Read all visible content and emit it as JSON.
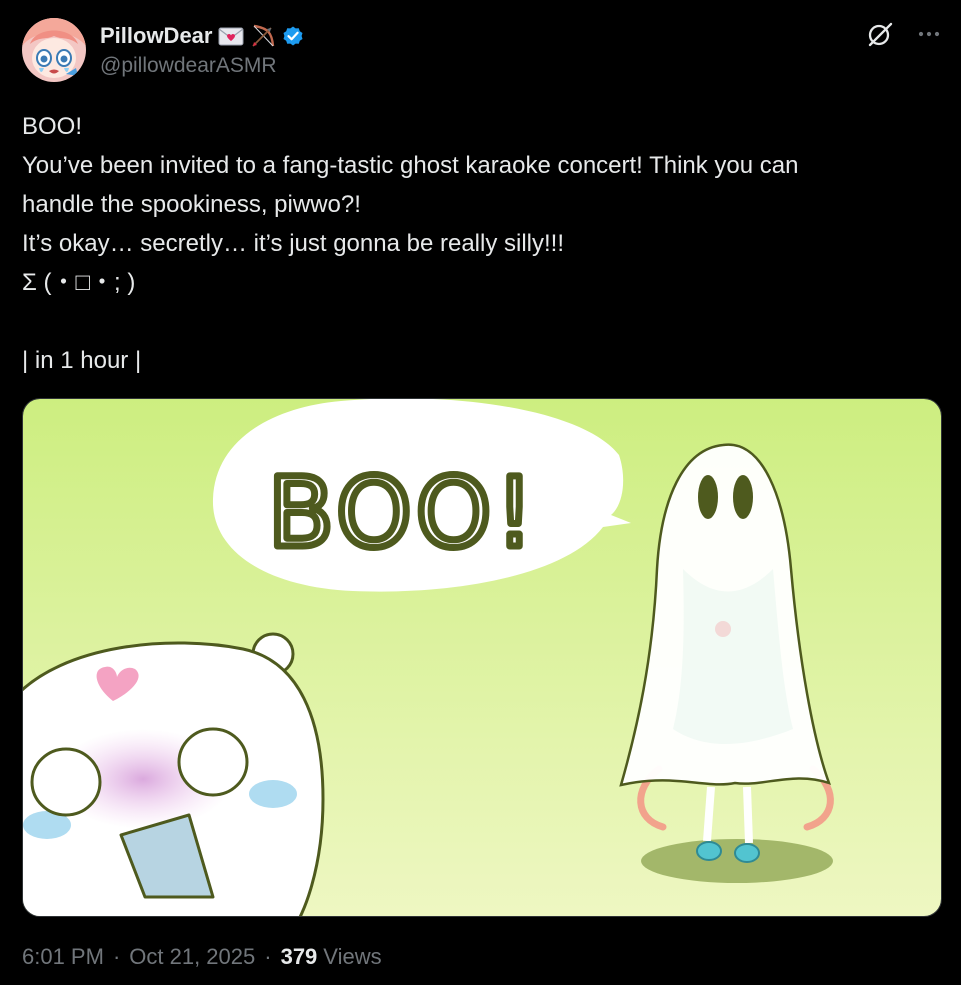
{
  "user": {
    "display_name": "PillowDear",
    "emojis": [
      "love-letter-emoji",
      "bow-and-arrow-emoji"
    ],
    "verified": true,
    "handle": "@pillowdearASMR"
  },
  "header_icons": [
    "grok-icon",
    "more-icon"
  ],
  "tweet": {
    "lines": [
      "BOO!",
      "You’ve been invited to a fang-tastic ghost karaoke concert! Think you can",
      "handle the spookiness, piwwo?!",
      "It’s okay… secretly… it’s just gonna be really silly!!!",
      "Σ (・□・; )",
      "",
      "| in 1 hour |"
    ]
  },
  "media": {
    "speech_bubble_text": "BOO!",
    "colors": {
      "background_top": "#cdee80",
      "background_bottom": "#eef7c2",
      "outline": "#4e5a1e"
    }
  },
  "meta": {
    "time": "6:01 PM",
    "separator": "·",
    "date": "Oct 21, 2025",
    "views_count": "379",
    "views_label": "Views"
  },
  "colors": {
    "background": "#000000",
    "text": "#e7e9ea",
    "secondary_text": "#71767b",
    "verified_blue": "#1d9bf0"
  }
}
